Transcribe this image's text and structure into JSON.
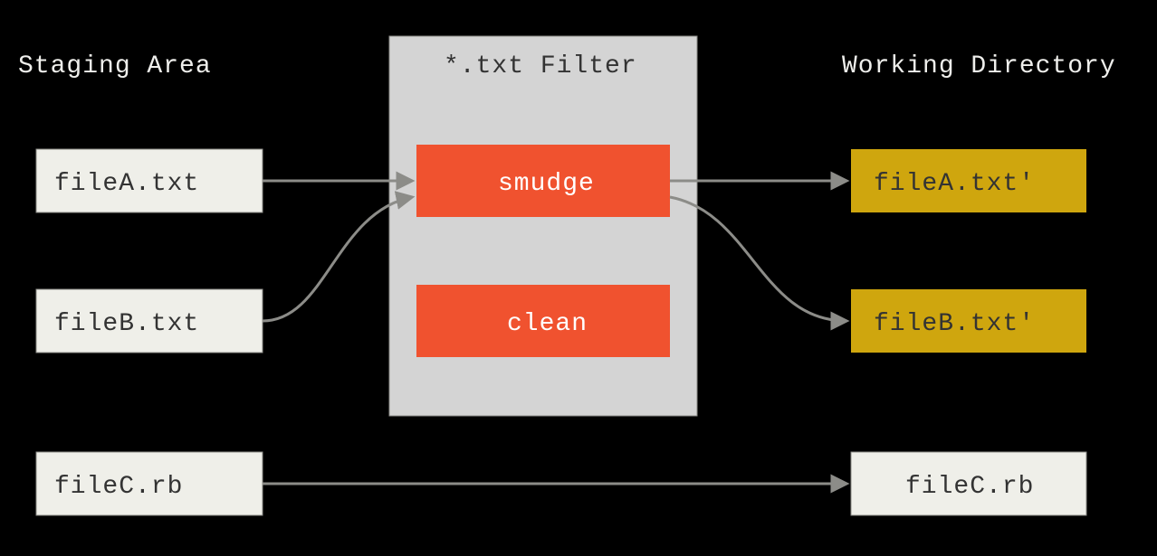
{
  "headings": {
    "staging": "Staging Area",
    "filter": "*.txt Filter",
    "working": "Working Directory"
  },
  "staging": {
    "fileA": "fileA.txt",
    "fileB": "fileB.txt",
    "fileC": "fileC.rb"
  },
  "filter": {
    "smudge": "smudge",
    "clean": "clean"
  },
  "working": {
    "fileA": "fileA.txt'",
    "fileB": "fileB.txt'",
    "fileC": "fileC.rb"
  }
}
